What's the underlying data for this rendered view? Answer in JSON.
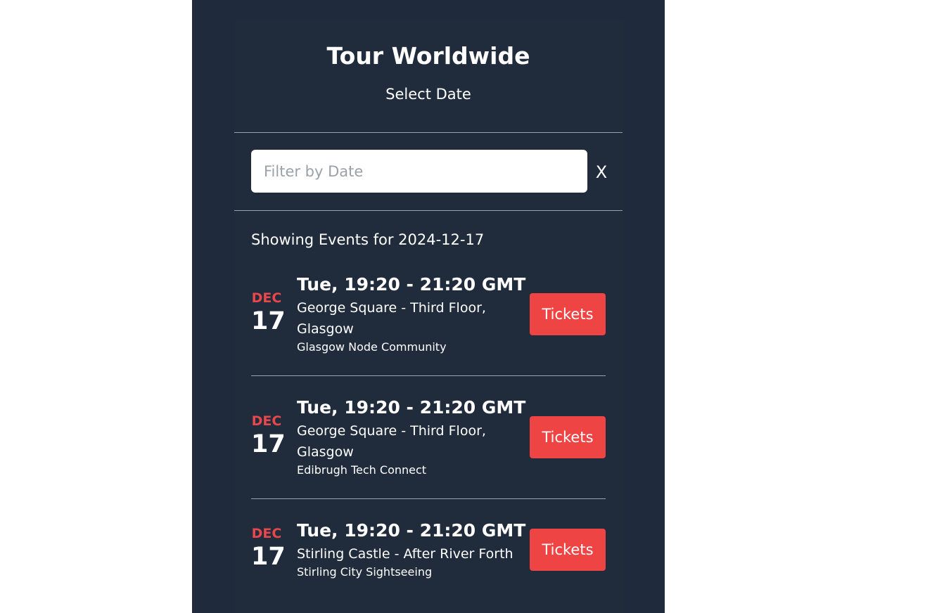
{
  "header": {
    "title": "Tour Worldwide",
    "subtitle": "Select Date"
  },
  "filter": {
    "placeholder": "Filter by Date",
    "value": "",
    "clear_label": "X"
  },
  "showing_text": "Showing Events for 2024-12-17",
  "events": [
    {
      "month": "DEC",
      "day": "17",
      "time": "Tue, 19:20 - 21:20 GMT",
      "venue": "George Square - Third Floor, Glasgow",
      "organizer": "Glasgow Node Community",
      "button_label": "Tickets"
    },
    {
      "month": "DEC",
      "day": "17",
      "time": "Tue, 19:20 - 21:20 GMT",
      "venue": "George Square - Third Floor, Glasgow",
      "organizer": "Edibrugh Tech Connect",
      "button_label": "Tickets"
    },
    {
      "month": "DEC",
      "day": "17",
      "time": "Tue, 19:20 - 21:20 GMT",
      "venue": "Stirling Castle - After River Forth",
      "organizer": "Stirling City Sightseeing",
      "button_label": "Tickets"
    }
  ],
  "colors": {
    "background": "#1f2a3c",
    "accent": "#ef4444",
    "month": "#e8474c"
  }
}
